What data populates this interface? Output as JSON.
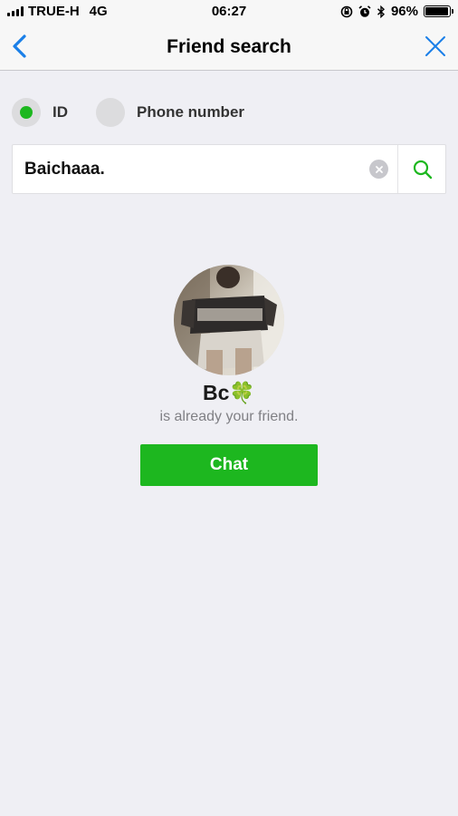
{
  "status_bar": {
    "carrier": "TRUE-H",
    "network": "4G",
    "time": "06:27",
    "battery": "96%",
    "battery_level": 0.96
  },
  "nav": {
    "title": "Friend search",
    "back_icon": "chevron-left-icon",
    "close_icon": "close-icon"
  },
  "search_type": {
    "options": [
      {
        "label": "ID",
        "selected": true
      },
      {
        "label": "Phone number",
        "selected": false
      }
    ]
  },
  "search": {
    "value": "Baichaaa."
  },
  "result": {
    "name": "Bc🍀",
    "status": "is already your friend.",
    "chat_label": "Chat"
  },
  "colors": {
    "accent_green": "#1db71f",
    "nav_blue": "#1a7fe8",
    "background": "#efeff4"
  }
}
